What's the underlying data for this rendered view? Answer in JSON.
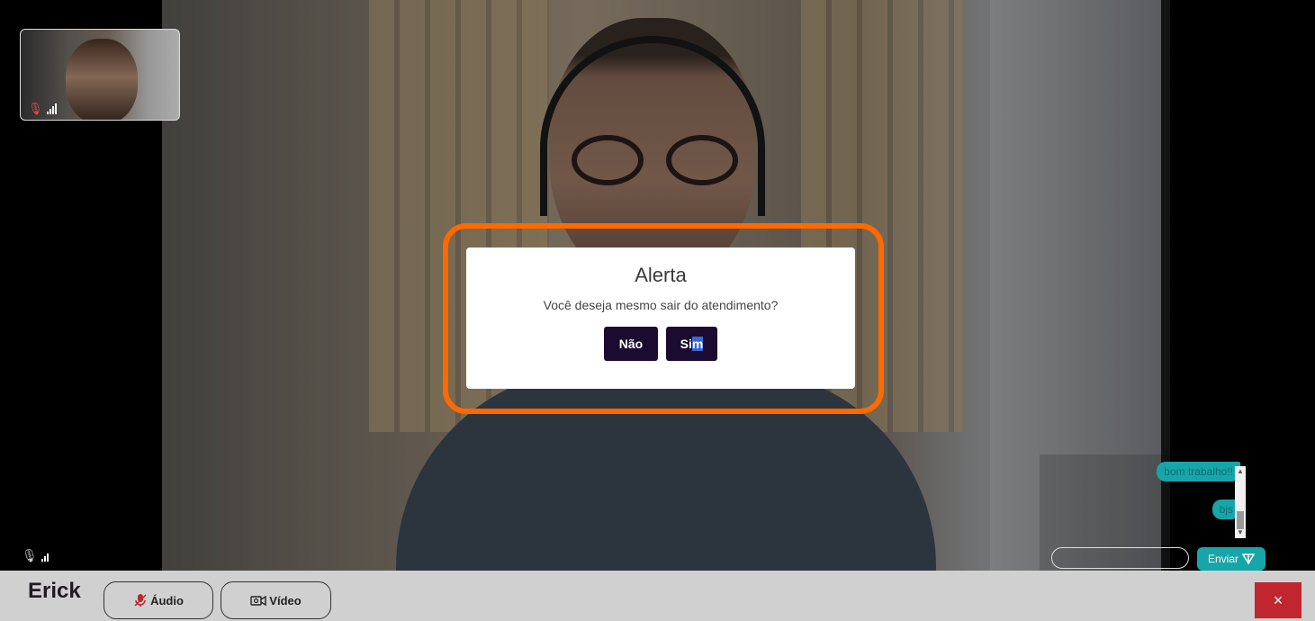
{
  "self_preview": {
    "mic_icon": "mic-muted-icon",
    "signal_icon": "signal-icon"
  },
  "main_video": {
    "mic_icon": "mic-icon",
    "signal_icon": "signal-icon"
  },
  "chat": {
    "messages": [
      "bom trabalho!!",
      "bjs"
    ],
    "input_value": "",
    "send_label": "Enviar",
    "send_icon": "send-icon"
  },
  "bottom_bar": {
    "caller_name": "Erick",
    "audio_label": "Áudio",
    "audio_icon": "mic-muted-icon",
    "video_label": "Vídeo",
    "video_icon": "video-camera-icon",
    "close_label": "×"
  },
  "modal": {
    "title": "Alerta",
    "message": "Você deseja mesmo sair do atendimento?",
    "no_label": "Não",
    "yes_label_prefix": "Si",
    "yes_label_selected": "m"
  },
  "colors": {
    "accent_teal": "#16a6a9",
    "dark_button": "#1b0b30",
    "close_red": "#c0262d",
    "highlight_orange": "#ff6a00"
  }
}
